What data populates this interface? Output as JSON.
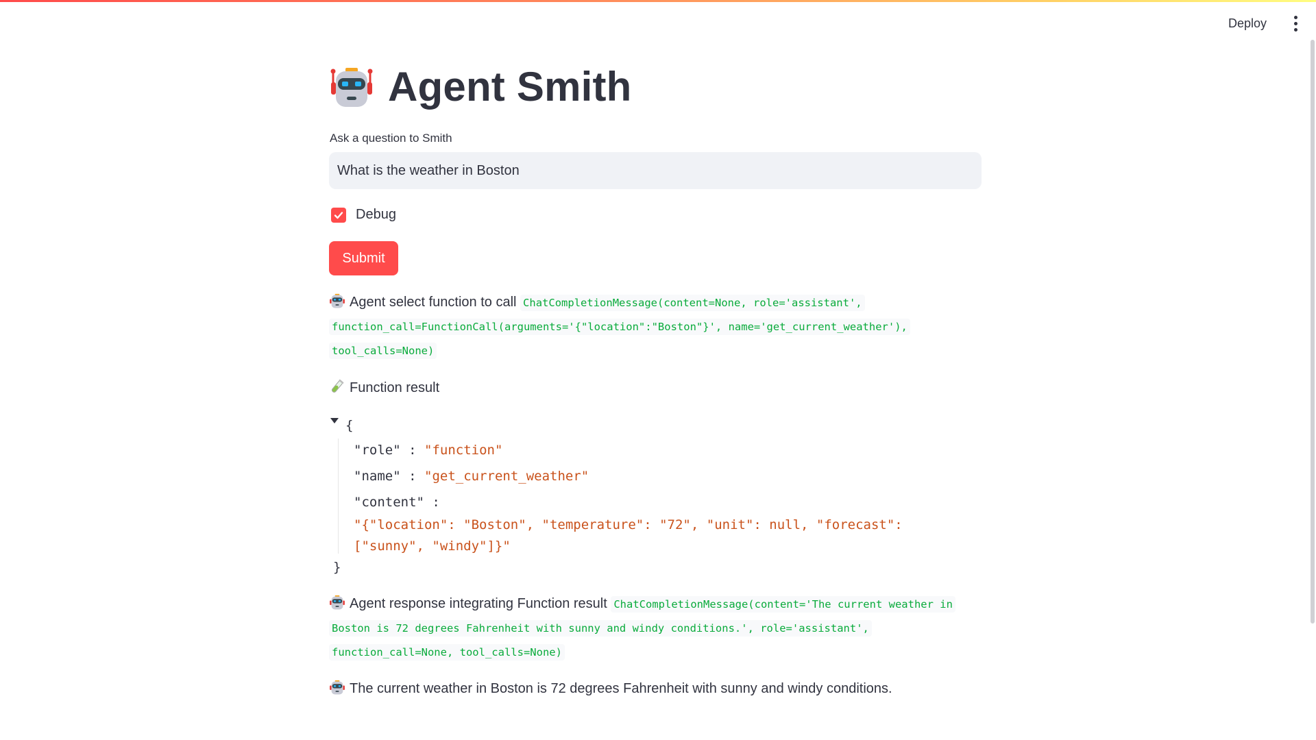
{
  "header": {
    "deploy_label": "Deploy",
    "menu_icon": "kebab-menu-icon"
  },
  "app": {
    "title": "Agent Smith",
    "title_icon": "robot-icon"
  },
  "form": {
    "question_label": "Ask a question to Smith",
    "question_value": "What is the weather in Boston",
    "debug_label": "Debug",
    "debug_checked": true,
    "submit_label": "Submit"
  },
  "messages": {
    "select_function": {
      "label": "Agent select function to call",
      "code": "ChatCompletionMessage(content=None, role='assistant', function_call=FunctionCall(arguments='{\"location\":\"Boston\"}', name='get_current_weather'), tool_calls=None)"
    },
    "function_result": {
      "label": "Function result",
      "icon": "test-tube-icon"
    },
    "result_json": {
      "open_brace": "{",
      "close_brace": "}",
      "role_key": "\"role\"",
      "role_value": "\"function\"",
      "name_key": "\"name\"",
      "name_value": "\"get_current_weather\"",
      "content_key": "\"content\"",
      "content_value": "\"{\"location\": \"Boston\", \"temperature\": \"72\", \"unit\": null, \"forecast\": [\"sunny\", \"windy\"]}\"",
      "separator": ":"
    },
    "integrating": {
      "label": "Agent response integrating Function result",
      "code": "ChatCompletionMessage(content='The current weather in Boston is 72 degrees Fahrenheit with sunny and windy conditions.', role='assistant', function_call=None, tool_calls=None)"
    },
    "final": {
      "text": "The current weather in Boston is 72 degrees Fahrenheit with sunny and windy conditions."
    }
  },
  "colors": {
    "accent": "#ff4b4b",
    "code_green": "#09ab3b",
    "json_string": "#c9521b",
    "text": "#31333f",
    "input_bg": "#f0f2f6"
  }
}
